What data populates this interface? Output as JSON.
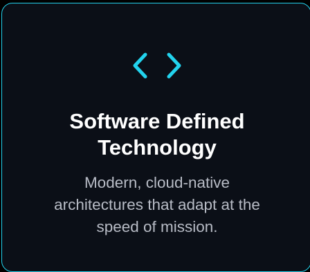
{
  "card": {
    "icon": "code-brackets-icon",
    "title_line1": "Software Defined",
    "title_line2": "Technology",
    "description_line1": "Modern, cloud-native",
    "description_line2": "architectures that adapt at the",
    "description_line3": "speed of mission."
  },
  "colors": {
    "accent": "#22d3ee",
    "background": "#0b0f17",
    "title": "#ffffff",
    "description": "#b8bcc6"
  }
}
